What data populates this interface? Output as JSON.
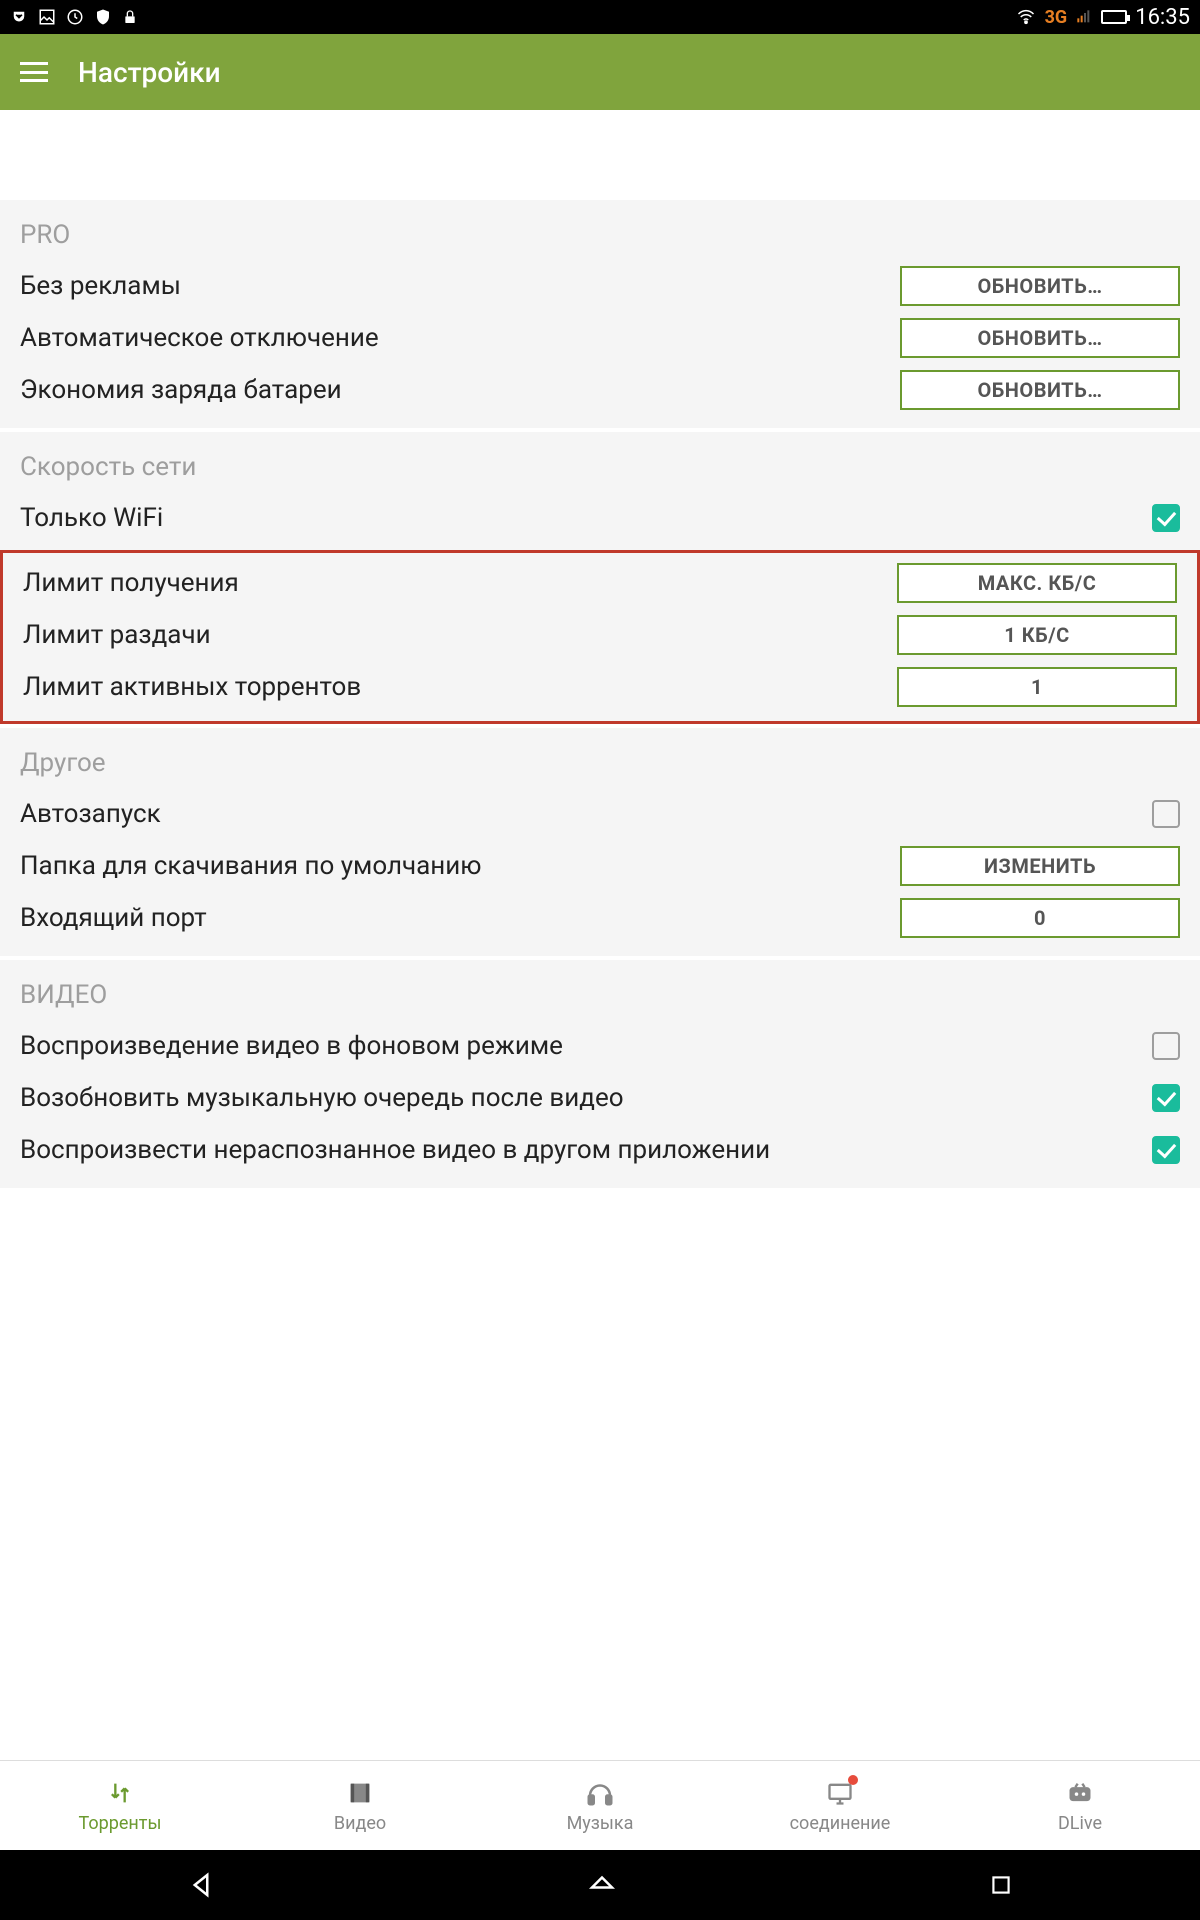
{
  "status": {
    "net_label": "3G",
    "signal_icon": "signal",
    "time": "16:35"
  },
  "appbar": {
    "title": "Настройки"
  },
  "sections": {
    "pro": {
      "header": "PRO",
      "rows": {
        "noads": {
          "label": "Без рекламы",
          "btn": "ОБНОВИТЬ…"
        },
        "autooff": {
          "label": "Автоматическое отключение",
          "btn": "ОБНОВИТЬ…"
        },
        "battery": {
          "label": "Экономия заряда батареи",
          "btn": "ОБНОВИТЬ…"
        }
      }
    },
    "netspeed": {
      "header": "Скорость сети",
      "wifi": {
        "label": "Только WiFi",
        "checked": true
      },
      "dl_limit": {
        "label": "Лимит получения",
        "btn": "МАКС. КБ/С"
      },
      "ul_limit": {
        "label": "Лимит раздачи",
        "btn": "1 КБ/С"
      },
      "active_limit": {
        "label": "Лимит активных торрентов",
        "btn": "1"
      }
    },
    "other": {
      "header": "Другое",
      "autostart": {
        "label": "Автозапуск",
        "checked": false
      },
      "folder": {
        "label": "Папка для скачивания по умолчанию",
        "btn": "ИЗМЕНИТЬ"
      },
      "port": {
        "label": "Входящий порт",
        "btn": "0"
      }
    },
    "video": {
      "header": "ВИДЕО",
      "bgplay": {
        "label": "Воспроизведение видео в фоновом режиме",
        "checked": false
      },
      "resume_queue": {
        "label": "Возобновить музыкальную очередь после видео",
        "checked": true
      },
      "unknown_ext": {
        "label": "Воспроизвести нераспознанное видео в другом приложении",
        "checked": true
      }
    }
  },
  "bottomnav": {
    "torrents": "Торренты",
    "video": "Видео",
    "music": "Музыка",
    "connection": "соединение",
    "dlive": "DLive"
  }
}
